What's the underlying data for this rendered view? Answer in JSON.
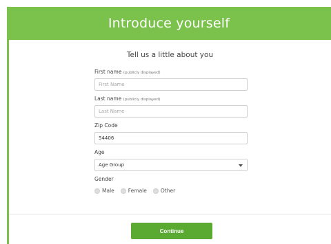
{
  "header": {
    "title": "Introduce yourself"
  },
  "form": {
    "subtitle": "Tell us a little about you",
    "first_name": {
      "label": "First name",
      "hint": "(publicly displayed)",
      "placeholder": "First Name",
      "value": ""
    },
    "last_name": {
      "label": "Last name",
      "hint": "(publicly displayed)",
      "placeholder": "Last Name",
      "value": ""
    },
    "zip": {
      "label": "Zip Code",
      "value": "54406"
    },
    "age": {
      "label": "Age",
      "selected": "Age Group"
    },
    "gender": {
      "label": "Gender",
      "options": [
        "Male",
        "Female",
        "Other"
      ]
    },
    "continue_label": "Continue"
  },
  "colors": {
    "accent": "#7bc24d",
    "button": "#5aaa32"
  }
}
